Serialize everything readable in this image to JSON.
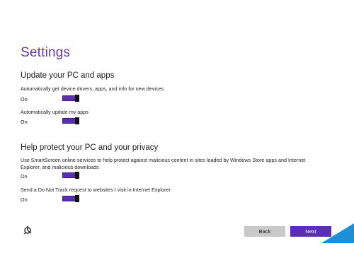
{
  "page": {
    "title": "Settings"
  },
  "sections": [
    {
      "heading": "Update your PC and apps",
      "settings": [
        {
          "description": "Automatically get device drivers, apps, and info for new devices",
          "state": "On",
          "on": true
        },
        {
          "description": "Automatically update my apps",
          "state": "On",
          "on": true
        }
      ]
    },
    {
      "heading": "Help protect your PC and your privacy",
      "settings": [
        {
          "description": "Use SmartScreen online services to help protect against malicious content in sites loaded by Windows Store apps and Internet Explorer, and malicious downloads",
          "state": "On",
          "on": true
        },
        {
          "description": "Send a Do Not Track request to websites I visit in Internet Explorer",
          "state": "On",
          "on": true
        }
      ]
    }
  ],
  "footer": {
    "ease_of_access_icon": "ease-of-access-icon",
    "back_label": "Back",
    "next_label": "Next"
  },
  "colors": {
    "accent": "#6b35b0",
    "toggle_fill": "#5b2eb8",
    "back_button": "#c9c9c9",
    "next_button": "#5b2eb8",
    "corner_accent": "#1e8fd6"
  }
}
